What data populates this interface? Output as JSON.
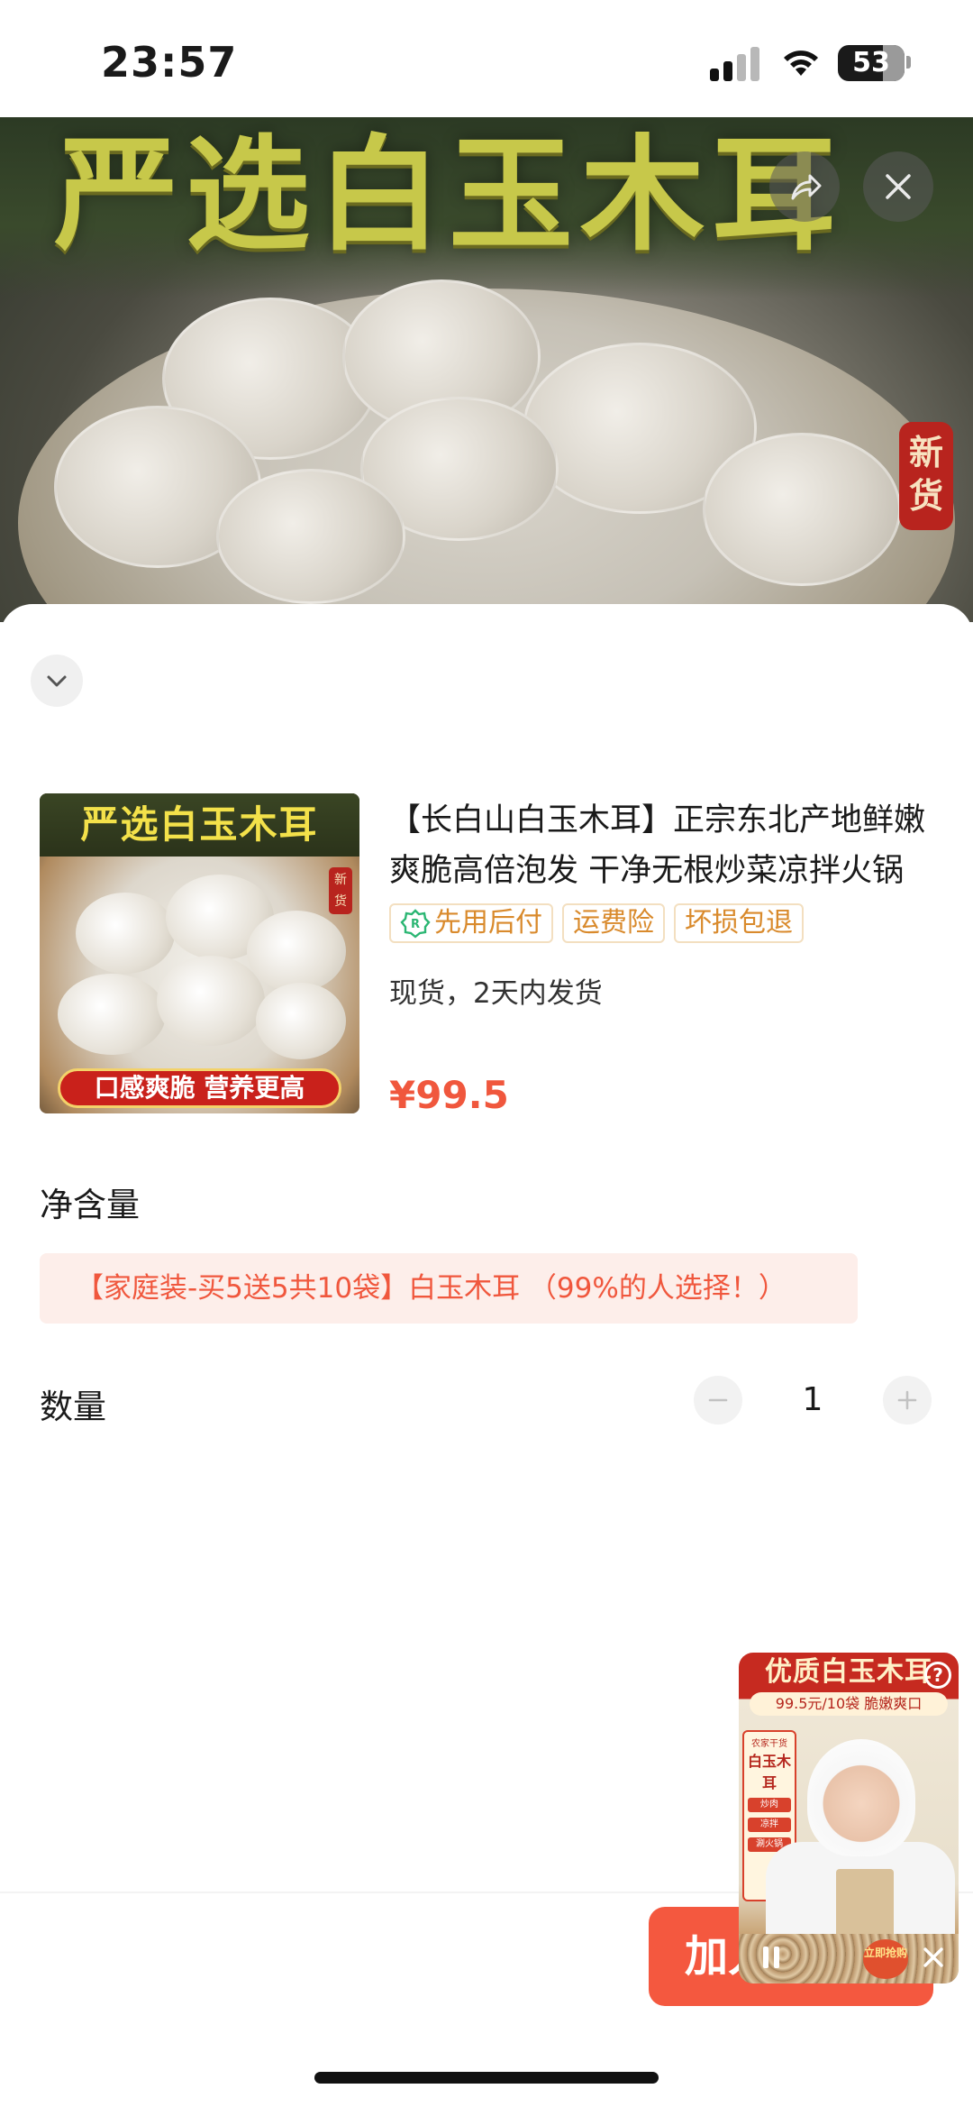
{
  "status_bar": {
    "time": "23:57",
    "battery": "53",
    "signal_icon": "cellular-signal-icon",
    "wifi_icon": "wifi-icon",
    "battery_icon": "battery-icon"
  },
  "hero": {
    "title": "严选白玉木耳",
    "badge": "新货",
    "share_icon": "share-icon",
    "close_icon": "close-icon"
  },
  "sheet": {
    "collapse_icon": "chevron-down-icon",
    "product": {
      "thumb_title": "严选白玉木耳",
      "thumb_banner": "口感爽脆 营养更高",
      "thumb_badge": "新货",
      "title": "【长白山白玉木耳】正宗东北产地鲜嫩爽脆高倍泡发 干净无根炒菜凉拌火锅",
      "tags": [
        "先用后付",
        "运费险",
        "坏损包退"
      ],
      "shipping": "现货，2天内发货",
      "price": "¥99.5"
    },
    "spec": {
      "label": "净含量",
      "selected_option": "【家庭装-买5送5共10袋】白玉木耳 （99%的人选择！）"
    },
    "quantity": {
      "label": "数量",
      "value": "1",
      "minus_icon": "minus-icon",
      "plus_icon": "plus-icon"
    },
    "footer": {
      "add_cart_label": "加入购物车"
    }
  },
  "video_float": {
    "title": "优质白玉木耳",
    "subtitle": "99.5元/10袋  脆嫩爽口",
    "board_head": "农家干货",
    "board_title": "白玉木耳",
    "board_items": [
      "炒肉",
      "凉拌",
      "涮火锅"
    ],
    "corner_badge": "立即抢购",
    "help_icon": "help-icon",
    "pause_icon": "pause-icon",
    "close_icon": "close-icon"
  },
  "colors": {
    "accent": "#f4583f",
    "price": "#f0573d",
    "tag_text": "#d98a2c",
    "spec_bg": "#fdeeea"
  }
}
